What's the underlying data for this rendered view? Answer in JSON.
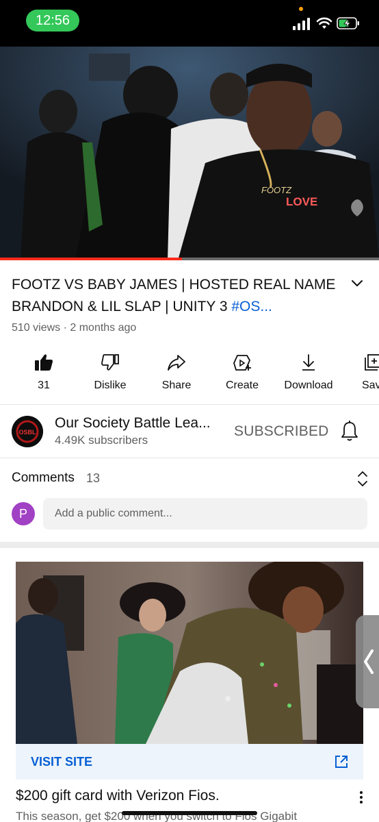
{
  "status_bar": {
    "time": "12:56",
    "icons": [
      "cellular-signal-icon",
      "wifi-icon",
      "battery-charging-icon"
    ],
    "pill_color": "#34c759"
  },
  "video": {
    "progress_fraction": 0.48,
    "progress_color": "#ff2b1c",
    "thumbnail_shirt_text": "FOOTZ",
    "thumbnail_logo_text": "LOVE"
  },
  "title": {
    "text": "FOOTZ VS BABY JAMES | HOSTED REAL NAME BRANDON & LIL SLAP | UNITY 3 ",
    "hashtag": "#OS...",
    "meta": "510 views · 2 months ago"
  },
  "actions": [
    {
      "label": "31",
      "icon": "thumbs-up-icon"
    },
    {
      "label": "Dislike",
      "icon": "thumbs-down-icon"
    },
    {
      "label": "Share",
      "icon": "share-icon"
    },
    {
      "label": "Create",
      "icon": "create-icon"
    },
    {
      "label": "Download",
      "icon": "download-icon"
    },
    {
      "label": "Sav",
      "icon": "save-playlist-icon"
    }
  ],
  "channel": {
    "name": "Our Society Battle Lea...",
    "subscribers": "4.49K subscribers",
    "subscribe_label": "SUBSCRIBED",
    "avatar_text": "OSBL"
  },
  "comments": {
    "label": "Comments",
    "count": "13",
    "user_initial": "P",
    "placeholder": "Add a public comment..."
  },
  "ad": {
    "cta": "VISIT SITE",
    "title": "$200 gift card with Verizon Fios.",
    "description": "This season, get $200 when you switch to Fios Gigabit"
  },
  "colors": {
    "link_blue": "#065fd4",
    "text_primary": "#0f0f0f",
    "text_secondary": "#606060",
    "avatar_purple": "#a141c4"
  }
}
